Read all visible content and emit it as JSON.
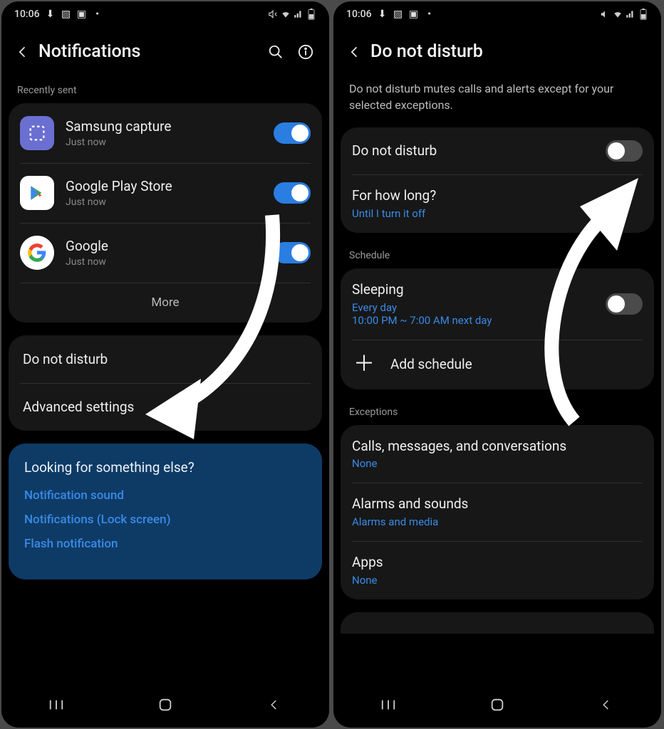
{
  "statusbar": {
    "time": "10:06"
  },
  "left": {
    "title": "Notifications",
    "section_recent": "Recently sent",
    "apps": [
      {
        "name": "Samsung capture",
        "sub": "Just now",
        "on": true
      },
      {
        "name": "Google Play Store",
        "sub": "Just now",
        "on": true
      },
      {
        "name": "Google",
        "sub": "Just now",
        "on": true
      }
    ],
    "more": "More",
    "dnd": "Do not disturb",
    "advanced": "Advanced settings",
    "looking": {
      "title": "Looking for something else?",
      "links": [
        "Notification sound",
        "Notifications (Lock screen)",
        "Flash notification"
      ]
    }
  },
  "right": {
    "title": "Do not disturb",
    "desc": "Do not disturb mutes calls and alerts except for your selected exceptions.",
    "master": {
      "label": "Do not disturb",
      "on": false
    },
    "how_long": {
      "label": "For how long?",
      "value": "Until I turn it off"
    },
    "schedule_label": "Schedule",
    "sleeping": {
      "title": "Sleeping",
      "days": "Every day",
      "time": "10:00 PM ~ 7:00 AM next day",
      "on": false
    },
    "add_schedule": "Add schedule",
    "exceptions_label": "Exceptions",
    "exceptions": [
      {
        "title": "Calls, messages, and conversations",
        "value": "None"
      },
      {
        "title": "Alarms and sounds",
        "value": "Alarms and media"
      },
      {
        "title": "Apps",
        "value": "None"
      }
    ]
  }
}
